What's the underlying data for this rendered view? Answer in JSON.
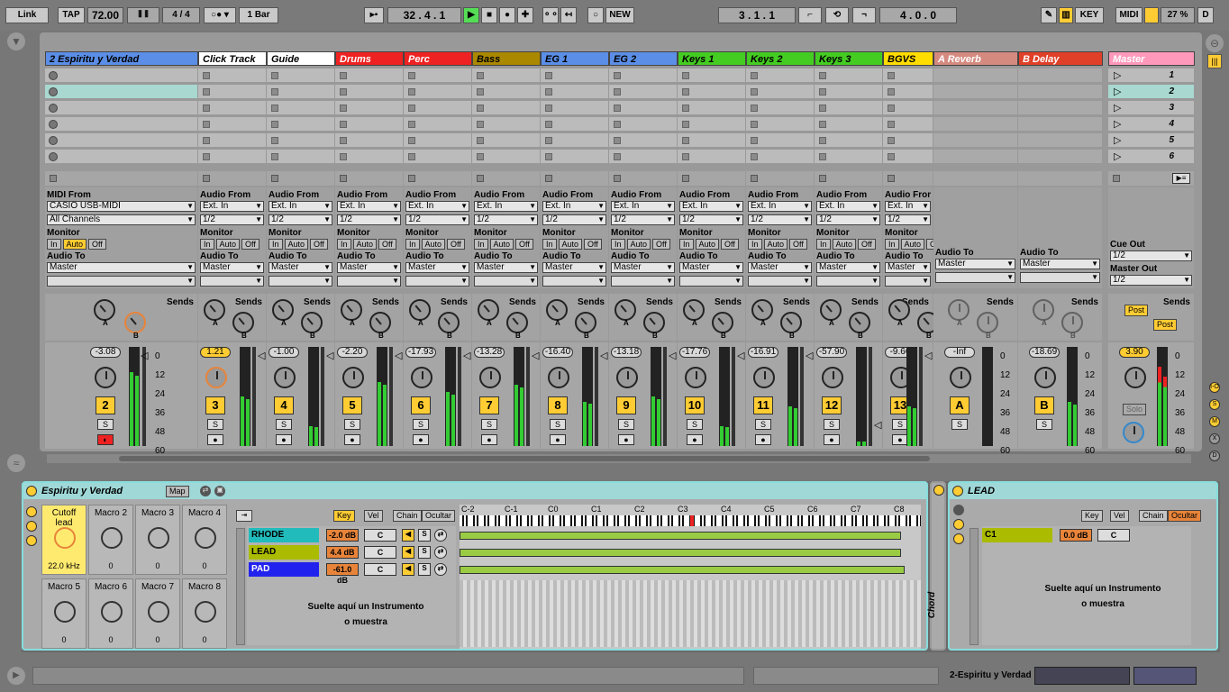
{
  "transport": {
    "link": "Link",
    "tap": "TAP",
    "tempo": "72.00",
    "sig_num": "4",
    "sig_den": "4",
    "quant": "1 Bar",
    "position": "32 .  4 .  1",
    "new": "NEW",
    "loop_start": "3 .  1 .  1",
    "loop_len": "4 .  0 .  0",
    "key": "KEY",
    "midi": "MIDI",
    "cpu": "27 %",
    "d": "D"
  },
  "tracks": [
    {
      "name": "2 Espiritu y Verdad",
      "color": "#5b8ee6",
      "type": "midi",
      "from": "CASIO USB-MIDI",
      "ch": "All Channels",
      "to": "Master",
      "vol": "-3.08",
      "num": "2"
    },
    {
      "name": "Click Track",
      "color": "#ffffff",
      "type": "audio",
      "from": "Ext. In",
      "ch": "1/2",
      "to": "Master",
      "vol": "1.21",
      "num": "3"
    },
    {
      "name": "Guide",
      "color": "#ffffff",
      "type": "audio",
      "from": "Ext. In",
      "ch": "1/2",
      "to": "Master",
      "vol": "-1.00",
      "num": "4"
    },
    {
      "name": "Drums",
      "color": "#ee2222",
      "type": "audio",
      "from": "Ext. In",
      "ch": "1/2",
      "to": "Master",
      "vol": "-2.20",
      "num": "5"
    },
    {
      "name": "Perc",
      "color": "#ee2222",
      "type": "audio",
      "from": "Ext. In",
      "ch": "1/2",
      "to": "Master",
      "vol": "-17.93",
      "num": "6"
    },
    {
      "name": "Bass",
      "color": "#aa8800",
      "type": "audio",
      "from": "Ext. In",
      "ch": "1/2",
      "to": "Master",
      "vol": "-13.28",
      "num": "7"
    },
    {
      "name": "EG 1",
      "color": "#5b8ee6",
      "type": "audio",
      "from": "Ext. In",
      "ch": "1/2",
      "to": "Master",
      "vol": "-16.40",
      "num": "8"
    },
    {
      "name": "EG 2",
      "color": "#5b8ee6",
      "type": "audio",
      "from": "Ext. In",
      "ch": "1/2",
      "to": "Master",
      "vol": "-13.18",
      "num": "9"
    },
    {
      "name": "Keys 1",
      "color": "#44cc22",
      "type": "audio",
      "from": "Ext. In",
      "ch": "1/2",
      "to": "Master",
      "vol": "-17.76",
      "num": "10"
    },
    {
      "name": "Keys 2",
      "color": "#44cc22",
      "type": "audio",
      "from": "Ext. In",
      "ch": "1/2",
      "to": "Master",
      "vol": "-16.91",
      "num": "11"
    },
    {
      "name": "Keys 3",
      "color": "#44cc22",
      "type": "audio",
      "from": "Ext. In",
      "ch": "1/2",
      "to": "Master",
      "vol": "-57.90",
      "num": "12"
    },
    {
      "name": "BGVS",
      "color": "#ffdd00",
      "type": "audio",
      "from": "Ext. In",
      "ch": "1/2",
      "to": "Master",
      "vol": "-9.66",
      "num": "13"
    }
  ],
  "returns": [
    {
      "name": "A Reverb",
      "color": "#d58a80",
      "to": "Master",
      "vol": "-Inf",
      "num": "A"
    },
    {
      "name": "B Delay",
      "color": "#e04028",
      "to": "Master",
      "vol": "-18.69",
      "num": "B"
    }
  ],
  "master": {
    "name": "Master",
    "color": "#ff99bb",
    "cue_label": "Cue Out",
    "cue": "1/2",
    "out_label": "Master Out",
    "out": "1/2",
    "vol": "3.90",
    "post": "Post",
    "solo": "Solo",
    "scenes": [
      "1",
      "2",
      "3",
      "4",
      "5",
      "6"
    ]
  },
  "labels": {
    "midi_from": "MIDI From",
    "audio_from": "Audio From",
    "monitor": "Monitor",
    "audio_to": "Audio To",
    "in": "In",
    "auto": "Auto",
    "off": "Off",
    "sends": "Sends",
    "s": "S"
  },
  "db_scale": [
    "0",
    "12",
    "24",
    "36",
    "48",
    "60"
  ],
  "rack": {
    "title": "Espiritu y Verdad",
    "map": "Map",
    "macros": [
      {
        "name": "Cutoff\nlead",
        "value": "22.0 kHz"
      },
      {
        "name": "Macro 2",
        "value": "0"
      },
      {
        "name": "Macro 3",
        "value": "0"
      },
      {
        "name": "Macro 4",
        "value": "0"
      },
      {
        "name": "Macro 5",
        "value": "0"
      },
      {
        "name": "Macro 6",
        "value": "0"
      },
      {
        "name": "Macro 7",
        "value": "0"
      },
      {
        "name": "Macro 8",
        "value": "0"
      }
    ],
    "tabs": [
      "Key",
      "Vel",
      "Chain",
      "Ocultar"
    ],
    "chains": [
      {
        "name": "RHODE",
        "color": "#22bbbb",
        "db": "-2.0 dB",
        "key": "C"
      },
      {
        "name": "LEAD",
        "color": "#aabb00",
        "db": "4.4 dB",
        "key": "C"
      },
      {
        "name": "PAD",
        "color": "#2222ee",
        "db": "-61.0 dB",
        "key": "C"
      }
    ],
    "drop": "Suelte aquí un Instrumento",
    "drop2": "o muestra",
    "keys": [
      "C-2",
      "C-1",
      "C0",
      "C1",
      "C2",
      "C3",
      "C4",
      "C5",
      "C6",
      "C7",
      "C8"
    ],
    "chord": "Chord"
  },
  "lead": {
    "title": "LEAD",
    "tabs": [
      "Key",
      "Vel",
      "Chain",
      "Ocultar"
    ],
    "chain": {
      "name": "C1",
      "db": "0.0 dB",
      "key": "C"
    },
    "drop": "Suelte aquí un Instrumento",
    "drop2": "o muestra"
  },
  "status": {
    "track": "2-Espiritu y Verdad"
  }
}
